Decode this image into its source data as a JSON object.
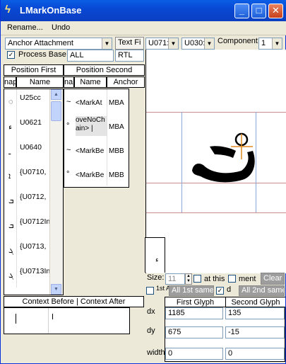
{
  "window": {
    "title": "LMarkOnBase",
    "app_icon": "lightning-icon"
  },
  "menu": [
    "Rename...",
    "Undo"
  ],
  "toolbar": {
    "lookup_type": "Anchor Attachment",
    "text_field_button": "Text Fi",
    "glyph1": "U071:",
    "glyph2": "U030:",
    "component_label": "Component:",
    "component_value": "1",
    "process_base_label": "Process Base",
    "script_field": "ALL",
    "direction_field": "RTL"
  },
  "first_list": {
    "header": "Position First",
    "col_map": "nap",
    "col_name": "Name",
    "rows": [
      {
        "name": "U25cc",
        "glyph": "◌"
      },
      {
        "name": "U0621",
        "glyph": "ء"
      },
      {
        "name": "U0640",
        "glyph": "ـ"
      },
      {
        "name": "{U0710,",
        "glyph": "ܐ"
      },
      {
        "name": "{U0712,",
        "glyph": "ܒ"
      },
      {
        "name": "{U0712In",
        "glyph": "ܒ"
      },
      {
        "name": "{U0713,",
        "glyph": "ܓ"
      },
      {
        "name": "{U0713In",
        "glyph": "ܓ"
      }
    ]
  },
  "second_list": {
    "header": "Position Second",
    "col_map": "nap",
    "col_name": "Name",
    "col_anchor": "Anchor",
    "rows": [
      {
        "glyph": "~",
        "name": "<MarkAt",
        "anchor": "MBA"
      },
      {
        "glyph": "°",
        "name": "oveNoCh ain> |",
        "anchor": "MBA"
      },
      {
        "glyph": "~",
        "name": "<MarkBe",
        "anchor": "MBB"
      },
      {
        "glyph": "°",
        "name": "<MarkBe",
        "anchor": "MBB"
      }
    ]
  },
  "context": {
    "header": "Context Before | Context After"
  },
  "bottom": {
    "size_label": "Size:",
    "size_value": "11",
    "at_this_label": "at this",
    "ment_label": "ment",
    "clear_button": "Clear",
    "all_first_same": "All 1st same",
    "d_label": "d",
    "all_second_same": "All 2nd same",
    "tiny_label": "1st An"
  },
  "grid": {
    "col_first": "First Glyph",
    "col_second": "Second Glyph",
    "rows": [
      {
        "label": "dx",
        "first": "1185",
        "second": "135"
      },
      {
        "label": "dy",
        "first": "675",
        "second": "-15"
      },
      {
        "label": "width",
        "first": "0",
        "second": "0"
      }
    ]
  }
}
